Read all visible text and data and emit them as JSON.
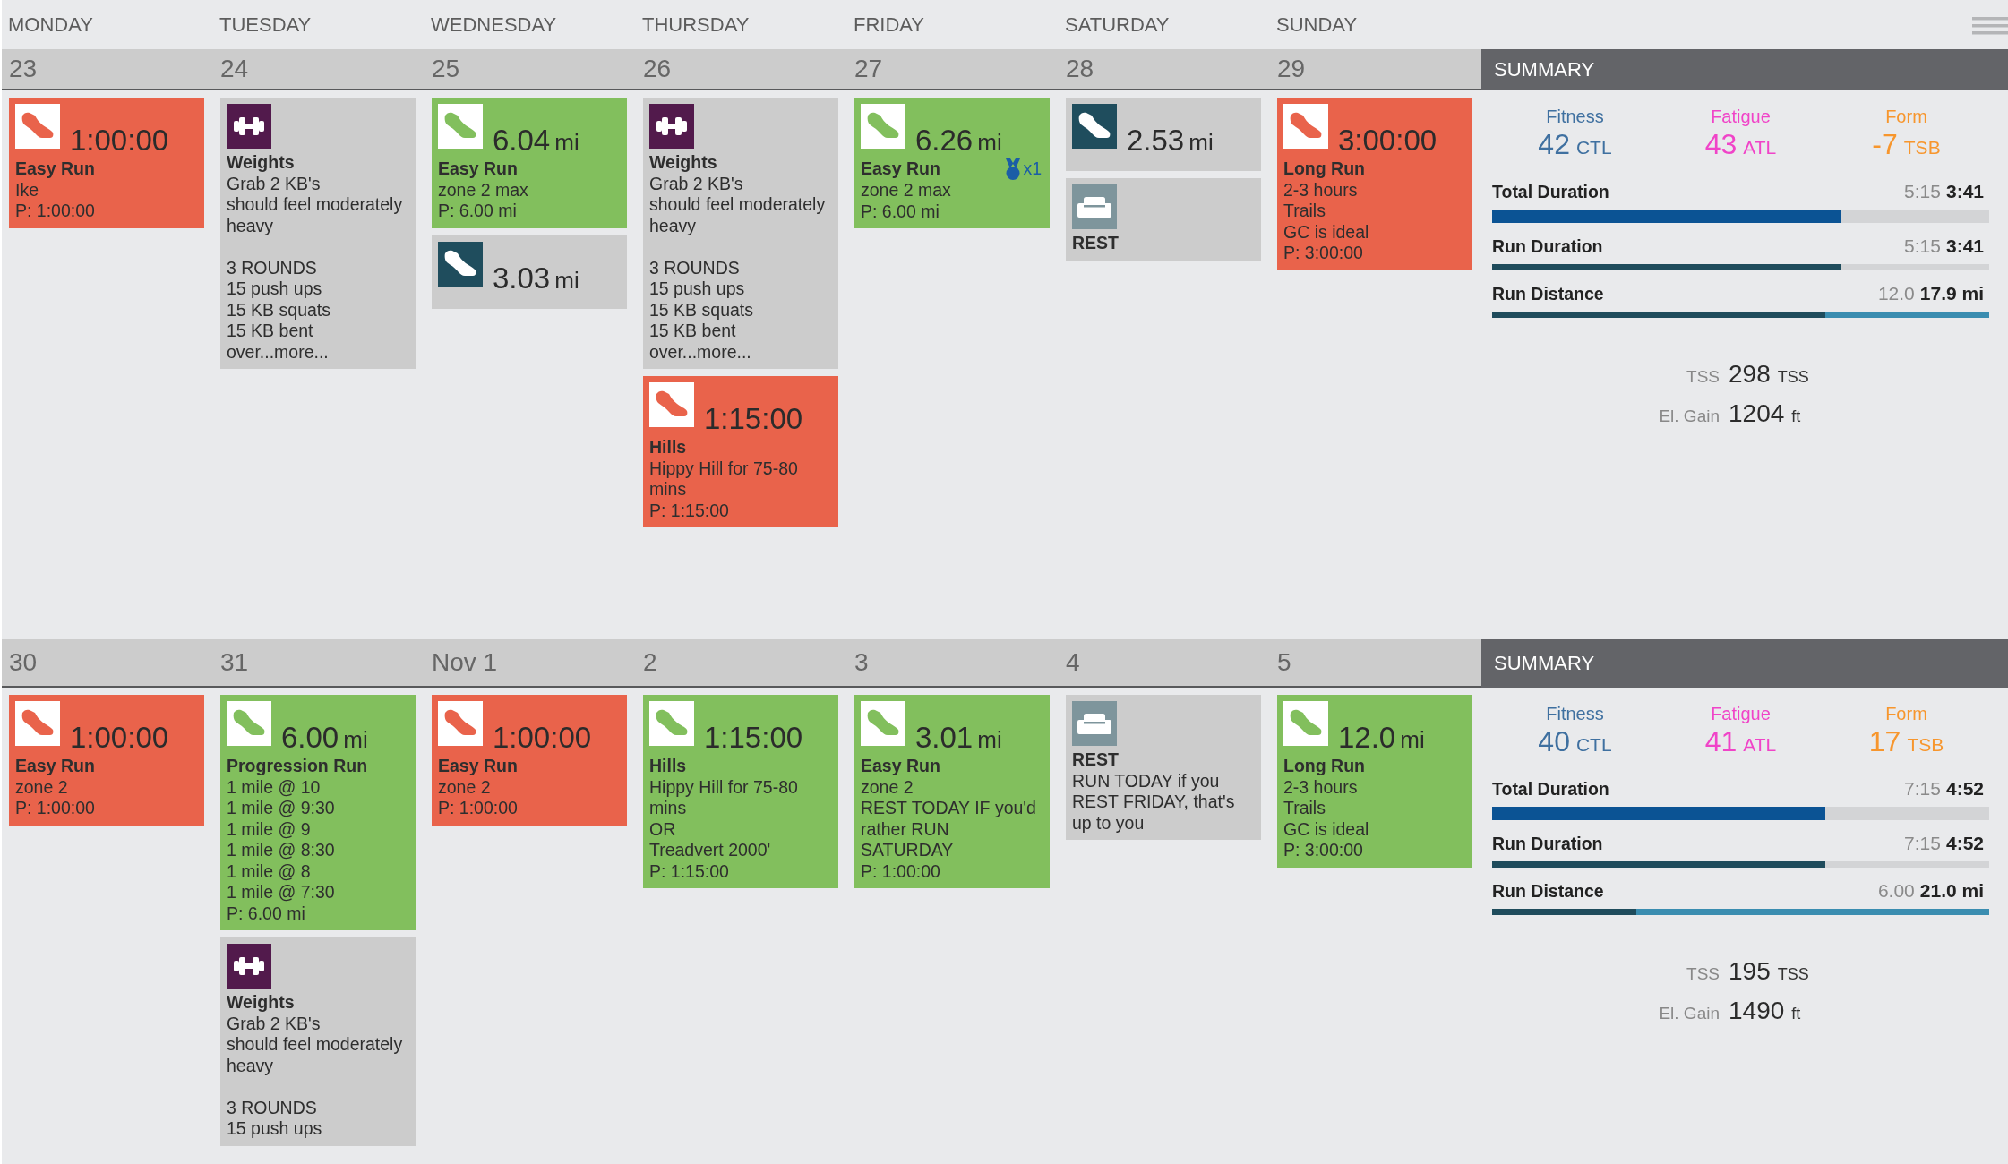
{
  "header": {
    "weekdays": [
      "MONDAY",
      "TUESDAY",
      "WEDNESDAY",
      "THURSDAY",
      "FRIDAY",
      "SATURDAY",
      "SUNDAY"
    ]
  },
  "weeks": [
    {
      "days": [
        {
          "date": "23",
          "workouts": [
            {
              "kind": "planned_run",
              "color": "#e9634b",
              "metric": "1:00:00",
              "title": "Easy Run",
              "description": "Ike",
              "planned": "P: 1:00:00"
            }
          ]
        },
        {
          "date": "24",
          "workouts": [
            {
              "kind": "strength",
              "color": "#cccccc",
              "title": "Weights",
              "description": "Grab 2 KB's\nshould feel moderately\nheavy\n\n3 ROUNDS\n15 push ups\n15 KB squats\n15 KB bent\nover...more..."
            }
          ]
        },
        {
          "date": "25",
          "workouts": [
            {
              "kind": "planned_run",
              "color": "#82bf5d",
              "metric": "6.04",
              "unit": "mi",
              "title": "Easy Run",
              "description": "zone 2 max",
              "planned": "P: 6.00 mi"
            },
            {
              "kind": "run",
              "color": "#cccccc",
              "metric": "3.03",
              "unit": "mi"
            }
          ]
        },
        {
          "date": "26",
          "workouts": [
            {
              "kind": "strength",
              "color": "#cccccc",
              "title": "Weights",
              "description": "Grab 2 KB's\nshould feel moderately\nheavy\n\n3 ROUNDS\n15 push ups\n15 KB squats\n15 KB bent\nover...more..."
            },
            {
              "kind": "planned_run",
              "color": "#e9634b",
              "metric": "1:15:00",
              "title": "Hills",
              "description": "Hippy Hill for 75-80\nmins",
              "planned": "P: 1:15:00"
            }
          ]
        },
        {
          "date": "27",
          "workouts": [
            {
              "kind": "planned_run",
              "color": "#82bf5d",
              "metric": "6.26",
              "unit": "mi",
              "title": "Easy Run",
              "badge": "x1",
              "description": "zone 2 max",
              "planned": "P: 6.00 mi"
            }
          ]
        },
        {
          "date": "28",
          "workouts": [
            {
              "kind": "run",
              "color": "#cccccc",
              "metric": "2.53",
              "unit": "mi"
            },
            {
              "kind": "rest",
              "color": "#cccccc",
              "title": "REST"
            }
          ]
        },
        {
          "date": "29",
          "workouts": [
            {
              "kind": "planned_run",
              "color": "#e9634b",
              "metric": "3:00:00",
              "title": "Long Run",
              "description": "2-3 hours\nTrails\nGC is ideal",
              "planned": "P: 3:00:00"
            }
          ]
        }
      ],
      "summary": {
        "title": "SUMMARY",
        "metrics": [
          {
            "label": "Fitness",
            "value": "42",
            "unit": "CTL",
            "color": "#3f70a0"
          },
          {
            "label": "Fatigue",
            "value": "43",
            "unit": "ATL",
            "color": "#f044c8"
          },
          {
            "label": "Form",
            "value": "-7",
            "unit": "TSB",
            "color": "#f7962d"
          }
        ],
        "bars": [
          {
            "kind": "total",
            "label": "Total Duration",
            "value": "5:15",
            "total": "3:41",
            "level": 0.7
          },
          {
            "kind": "duration",
            "label": "Run Duration",
            "value": "5:15",
            "total": "3:41",
            "level": 0.7
          },
          {
            "kind": "distance",
            "label": "Run Distance",
            "value": "12.0",
            "total": "17.9 mi",
            "level": 0.67
          }
        ],
        "stats": [
          {
            "label": "TSS",
            "value": "298",
            "unit": "TSS"
          },
          {
            "label": "El. Gain",
            "value": "1204",
            "unit": "ft"
          }
        ]
      }
    },
    {
      "days": [
        {
          "date": "30",
          "workouts": [
            {
              "kind": "planned_run",
              "color": "#e9634b",
              "metric": "1:00:00",
              "title": "Easy Run",
              "description": "zone 2",
              "planned": "P: 1:00:00"
            }
          ]
        },
        {
          "date": "31",
          "workouts": [
            {
              "kind": "planned_run",
              "color": "#82bf5d",
              "metric": "6.00",
              "unit": "mi",
              "title": "Progression Run",
              "description": "1 mile @ 10\n1 mile @ 9:30\n1 mile @ 9\n1 mile @ 8:30\n1 mile @ 8\n1 mile @ 7:30",
              "planned": "P: 6.00 mi"
            },
            {
              "kind": "strength",
              "color": "#cccccc",
              "title": "Weights",
              "description": "Grab 2 KB's\nshould feel moderately\nheavy\n\n3 ROUNDS\n15 push ups"
            }
          ]
        },
        {
          "date": "Nov 1",
          "workouts": [
            {
              "kind": "planned_run",
              "color": "#e9634b",
              "metric": "1:00:00",
              "title": "Easy Run",
              "description": "zone 2",
              "planned": "P: 1:00:00"
            }
          ]
        },
        {
          "date": "2",
          "workouts": [
            {
              "kind": "planned_run",
              "color": "#82bf5d",
              "metric": "1:15:00",
              "title": "Hills",
              "description": "Hippy Hill for 75-80\nmins\nOR\nTreadvert 2000'",
              "planned": "P: 1:15:00"
            }
          ]
        },
        {
          "date": "3",
          "workouts": [
            {
              "kind": "planned_run",
              "color": "#82bf5d",
              "metric": "3.01",
              "unit": "mi",
              "title": "Easy Run",
              "description": "zone 2\nREST TODAY IF you'd\nrather RUN\nSATURDAY",
              "planned": "P: 1:00:00"
            }
          ]
        },
        {
          "date": "4",
          "workouts": [
            {
              "kind": "rest",
              "color": "#cccccc",
              "title": "REST",
              "description": "RUN TODAY if you\nREST FRIDAY, that's\nup to you"
            }
          ]
        },
        {
          "date": "5",
          "workouts": [
            {
              "kind": "planned_run",
              "color": "#82bf5d",
              "metric": "12.0",
              "unit": "mi",
              "title": "Long Run",
              "description": "2-3 hours\nTrails\nGC is ideal",
              "planned": "P: 3:00:00"
            }
          ]
        }
      ],
      "summary": {
        "title": "SUMMARY",
        "metrics": [
          {
            "label": "Fitness",
            "value": "40",
            "unit": "CTL",
            "color": "#3f70a0"
          },
          {
            "label": "Fatigue",
            "value": "41",
            "unit": "ATL",
            "color": "#f044c8"
          },
          {
            "label": "Form",
            "value": "17",
            "unit": "TSB",
            "color": "#f7962d"
          }
        ],
        "bars": [
          {
            "kind": "total",
            "label": "Total Duration",
            "value": "7:15",
            "total": "4:52",
            "level": 0.67
          },
          {
            "kind": "duration",
            "label": "Run Duration",
            "value": "7:15",
            "total": "4:52",
            "level": 0.67
          },
          {
            "kind": "distance",
            "label": "Run Distance",
            "value": "6.00",
            "total": "21.0 mi",
            "level": 0.29
          }
        ],
        "stats": [
          {
            "label": "TSS",
            "value": "195",
            "unit": "TSS"
          },
          {
            "label": "El. Gain",
            "value": "1490",
            "unit": "ft"
          }
        ]
      }
    }
  ]
}
